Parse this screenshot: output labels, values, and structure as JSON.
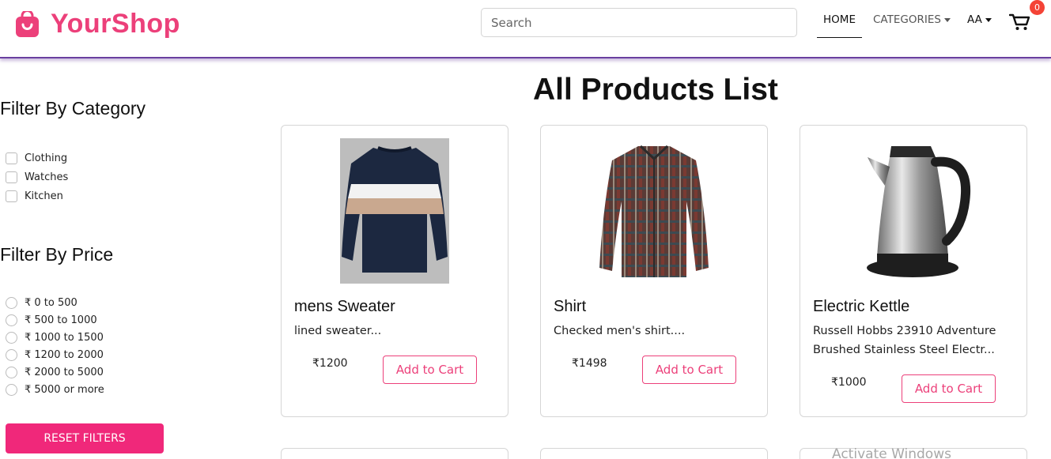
{
  "header": {
    "brand_name": "YourShop",
    "brand_icon": "shopping-bag-icon",
    "search_placeholder": "Search",
    "nav": {
      "home": "HOME",
      "categories": "CATEGORIES",
      "language": "AA"
    },
    "cart_icon": "cart-icon",
    "cart_count": "0",
    "brand_color": "#ec407a",
    "border_color": "#6a3fa0"
  },
  "sidebar": {
    "category_title": "Filter By Category",
    "categories": [
      "Clothing",
      "Watches",
      "Kitchen"
    ],
    "price_title": "Filter By Price",
    "prices": [
      "₹ 0 to 500",
      "₹ 500 to 1000",
      "₹ 1000 to 1500",
      "₹ 1200 to 2000",
      "₹ 2000 to 5000",
      "₹ 5000 or more"
    ],
    "reset_label": "RESET FILTERS"
  },
  "main": {
    "title": "All Products List",
    "products": [
      {
        "name": "mens Sweater",
        "desc": "lined sweater...",
        "price": "₹1200",
        "button": "Add to Cart"
      },
      {
        "name": "Shirt",
        "desc": "Checked men's shirt....",
        "price": "₹1498",
        "button": "Add to Cart"
      },
      {
        "name": "Electric Kettle",
        "desc": "Russell Hobbs 23910 Adventure Brushed Stainless Steel Electr...",
        "price": "₹1000",
        "button": "Add to Cart"
      }
    ]
  },
  "watermark": "Activate Windows"
}
